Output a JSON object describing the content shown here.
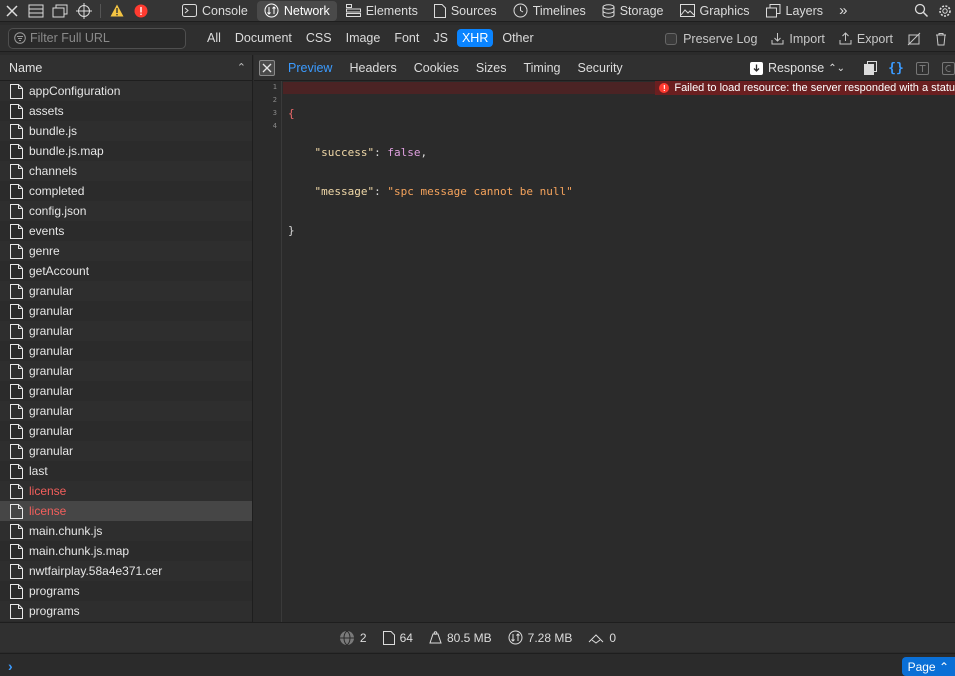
{
  "toolbar": {
    "tabs": [
      {
        "label": "Console",
        "icon": "console-icon"
      },
      {
        "label": "Network",
        "icon": "network-icon",
        "active": true
      },
      {
        "label": "Elements",
        "icon": "elements-icon"
      },
      {
        "label": "Sources",
        "icon": "sources-icon"
      },
      {
        "label": "Timelines",
        "icon": "timelines-icon"
      },
      {
        "label": "Storage",
        "icon": "storage-icon"
      },
      {
        "label": "Graphics",
        "icon": "graphics-icon"
      },
      {
        "label": "Layers",
        "icon": "layers-icon"
      }
    ],
    "more": "»"
  },
  "filter": {
    "placeholder": "Filter Full URL",
    "types": [
      "All",
      "Document",
      "CSS",
      "Image",
      "Font",
      "JS",
      "XHR",
      "Other"
    ],
    "active_type": "XHR",
    "preserve_log": "Preserve Log",
    "import": "Import",
    "export": "Export"
  },
  "list": {
    "header": "Name",
    "items": [
      {
        "name": "appConfiguration"
      },
      {
        "name": "assets"
      },
      {
        "name": "bundle.js"
      },
      {
        "name": "bundle.js.map"
      },
      {
        "name": "channels"
      },
      {
        "name": "completed"
      },
      {
        "name": "config.json"
      },
      {
        "name": "events"
      },
      {
        "name": "genre"
      },
      {
        "name": "getAccount"
      },
      {
        "name": "granular"
      },
      {
        "name": "granular"
      },
      {
        "name": "granular"
      },
      {
        "name": "granular"
      },
      {
        "name": "granular"
      },
      {
        "name": "granular"
      },
      {
        "name": "granular"
      },
      {
        "name": "granular"
      },
      {
        "name": "granular"
      },
      {
        "name": "last"
      },
      {
        "name": "license",
        "error": true
      },
      {
        "name": "license",
        "error": true,
        "selected": true
      },
      {
        "name": "main.chunk.js"
      },
      {
        "name": "main.chunk.js.map"
      },
      {
        "name": "nwtfairplay.58a4e371.cer"
      },
      {
        "name": "programs"
      },
      {
        "name": "programs"
      }
    ]
  },
  "detail": {
    "tabs": [
      "Preview",
      "Headers",
      "Cookies",
      "Sizes",
      "Timing",
      "Security"
    ],
    "active_tab": "Preview",
    "response_select": "Response",
    "error_message": "Failed to load resource: the server responded with a statu",
    "line_numbers": [
      "1",
      "2",
      "3",
      "4"
    ],
    "code": {
      "open": "{",
      "key1": "\"success\"",
      "val1": "false",
      "key2": "\"message\"",
      "val2": "\"spc message cannot be null\"",
      "close": "}"
    }
  },
  "status": {
    "domains": "2",
    "resources": "64",
    "size": "80.5 MB",
    "transferred": "7.28 MB",
    "time": "0"
  },
  "console": {
    "prompt": "›",
    "page_button": "Page ⌃"
  },
  "colors": {
    "accent": "#0a84ff",
    "error": "#f25f5c",
    "background": "#2b2b2b"
  }
}
